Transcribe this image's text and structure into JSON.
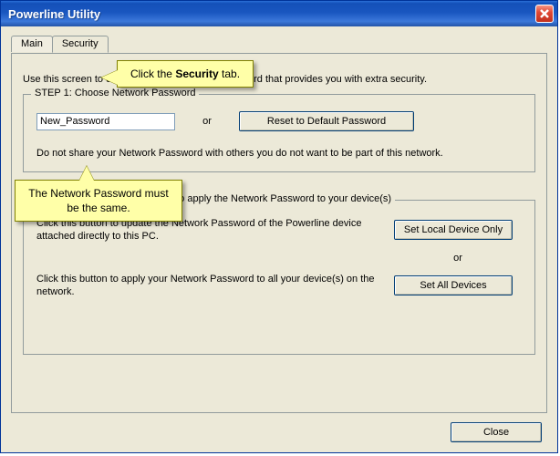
{
  "window": {
    "title": "Powerline Utility"
  },
  "tabs": {
    "main": "Main",
    "security": "Security"
  },
  "intro": "Use this screen to create a Private Network Password that provides you with extra security.",
  "step1": {
    "legend": "STEP 1: Choose Network Password",
    "password_value": "New_Password",
    "or": "or",
    "reset_button": "Reset to Default Password",
    "note": "Do not share your Network Password with others you do not want to be part of this network."
  },
  "step2": {
    "legend": "STEP 2: Choose how you want to apply the Network Password to your device(s)",
    "text_local": "Click this button to update the Network Password of the Powerline device attached directly to this PC.",
    "btn_local": "Set Local Device Only",
    "or": "or",
    "text_all": "Click this button to apply your Network Password to all your device(s) on the network.",
    "btn_all": "Set All Devices"
  },
  "footer": {
    "close": "Close"
  },
  "callout1": {
    "prefix": "Click the ",
    "bold": "Security",
    "suffix": " tab."
  },
  "callout2": {
    "text": "The Network Password must be the same."
  }
}
